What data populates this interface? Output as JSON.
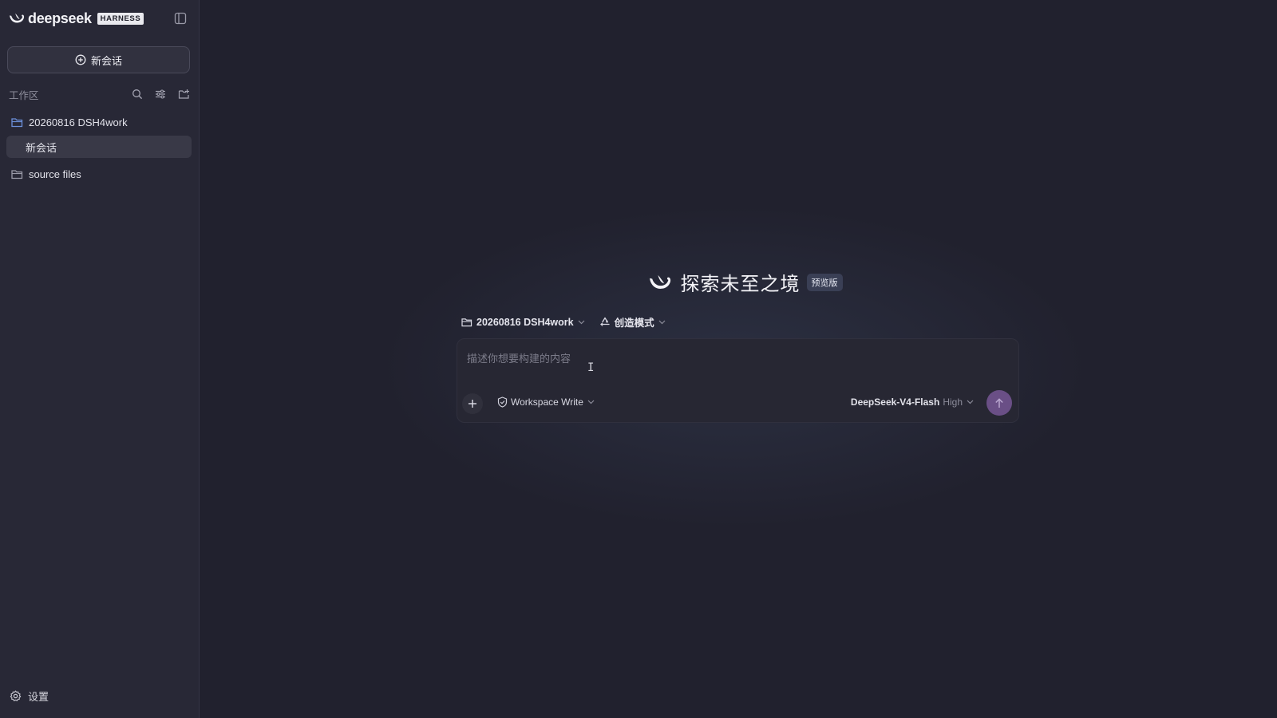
{
  "sidebar": {
    "brand": {
      "name": "deepseek",
      "badge": "HARNESS"
    },
    "new_chat_label": "新会话",
    "workspace_label": "工作区",
    "tree": [
      {
        "label": "20260816 DSH4work",
        "icon": "folder-open-icon"
      },
      {
        "label": "新会话",
        "active": true
      },
      {
        "label": "source files",
        "icon": "folder-icon"
      }
    ],
    "settings_label": "设置"
  },
  "main": {
    "hero": {
      "title": "探索未至之境",
      "badge": "预览版"
    },
    "project_selector": "20260816 DSH4work",
    "mode_selector": "创造模式",
    "composer": {
      "placeholder": "描述你想要构建的内容",
      "value": "",
      "permission": "Workspace Write",
      "model": "DeepSeek-V4-Flash",
      "effort": "High"
    }
  },
  "colors": {
    "background": "#21212e",
    "sidebar": "#282836",
    "accent_send": "#6a4f86",
    "folder_blue": "#6c8fd9"
  }
}
